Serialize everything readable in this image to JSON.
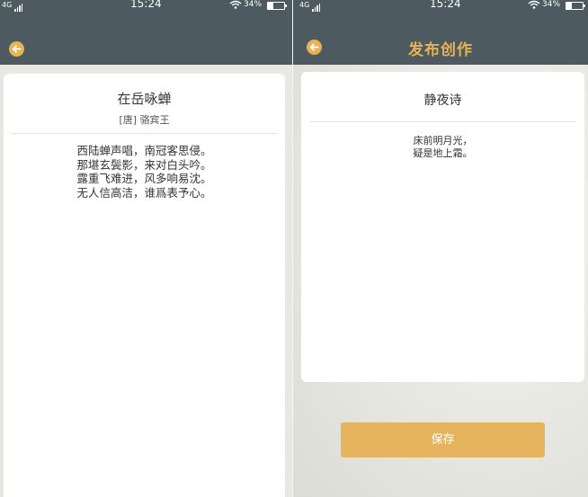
{
  "status_bar": {
    "left": {
      "network": "4G",
      "time": "15:24",
      "battery": "34%"
    },
    "right": {
      "network": "4G",
      "time": "15:24",
      "battery": "34%"
    },
    "battery_level": 0.34
  },
  "left_screen": {
    "back_icon": "arrow-left-icon",
    "poem": {
      "title": "在岳咏蝉",
      "author": "[唐] 骆宾王",
      "lines": [
        "西陆蝉声唱，南冠客思侵。",
        "那堪玄鬓影，来对白头吟。",
        "露重飞难进，风多响易沈。",
        "无人信高洁，谁爲表予心。"
      ]
    }
  },
  "right_screen": {
    "back_icon": "arrow-left-icon",
    "header_title": "发布创作",
    "poem": {
      "title": "静夜诗",
      "lines": [
        "床前明月光，",
        "疑是地上霜。"
      ]
    },
    "save_label": "保存"
  },
  "colors": {
    "header": "#4d5a5f",
    "accent": "#e8b257",
    "button": "#e6b45c"
  }
}
